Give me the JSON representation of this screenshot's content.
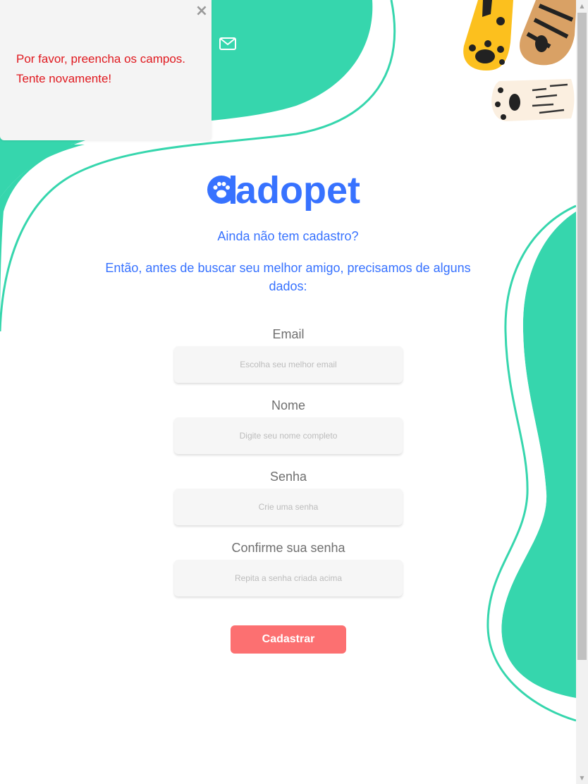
{
  "toast": {
    "close_glyph": "×",
    "message": "Por favor, preencha os campos. Tente novamente!"
  },
  "header": {
    "mail_icon": "mail-icon"
  },
  "logo": {
    "text": "adopet",
    "icon": "paw-icon"
  },
  "intro": {
    "question": "Ainda não tem cadastro?",
    "explanation": "Então, antes de buscar seu melhor amigo, precisamos de alguns dados:"
  },
  "form": {
    "email": {
      "label": "Email",
      "placeholder": "Escolha seu melhor email"
    },
    "name": {
      "label": "Nome",
      "placeholder": "Digite seu nome completo"
    },
    "password": {
      "label": "Senha",
      "placeholder": "Crie uma senha"
    },
    "confirm": {
      "label": "Confirme sua senha",
      "placeholder": "Repita a senha criada acima"
    },
    "submit_label": "Cadastrar"
  },
  "colors": {
    "accent_green": "#36d6ad",
    "brand_blue": "#3772ff",
    "button_coral": "#fc7071",
    "error_red": "#e0191f"
  }
}
